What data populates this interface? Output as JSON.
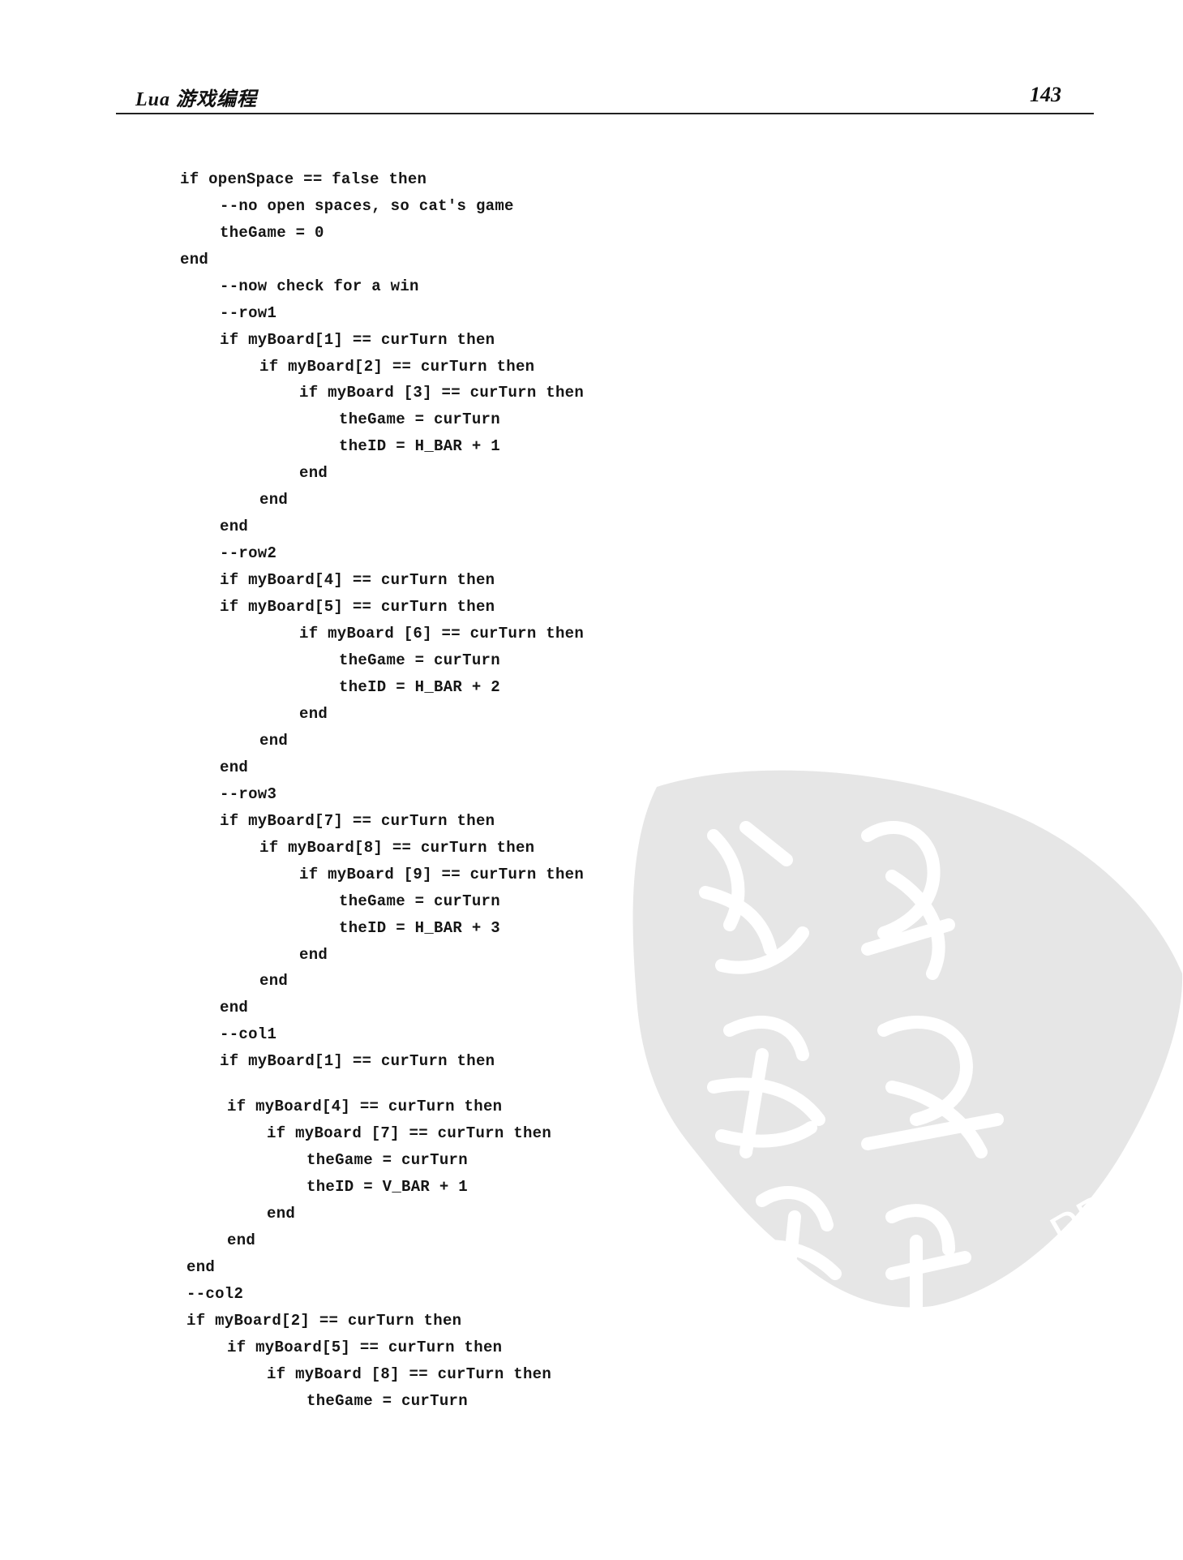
{
  "header": {
    "book_title": "Lua 游戏编程",
    "page_number": "143"
  },
  "watermark": {
    "label": "PDG",
    "colors": {
      "seal": "#e6e6e6",
      "glyph": "#ffffff"
    }
  },
  "code_lines": [
    "if openSpace == false then",
    "--no open spaces, so cat's game",
    "theGame = 0",
    "end",
    "--now check for a win",
    "--row1",
    "if myBoard[1] == curTurn then",
    "if myBoard[2] == curTurn then",
    "if myBoard [3] == curTurn then",
    "theGame = curTurn",
    "theID = H_BAR + 1",
    "end",
    "end",
    "end",
    "--row2",
    "if myBoard[4] == curTurn then",
    "if myBoard[5] == curTurn then",
    "if myBoard [6] == curTurn then",
    "theGame = curTurn",
    "theID = H_BAR + 2",
    "end",
    "end",
    "end",
    "--row3",
    "if myBoard[7] == curTurn then",
    "if myBoard[8] == curTurn then",
    "if myBoard [9] == curTurn then",
    "theGame = curTurn",
    "theID = H_BAR + 3",
    "end",
    "end",
    "end",
    "--col1",
    "if myBoard[1] == curTurn then",
    "if myBoard[4] == curTurn then",
    "if myBoard [7] == curTurn then",
    "theGame = curTurn",
    "theID = V_BAR + 1",
    "end",
    "end",
    "end",
    "--col2",
    "if myBoard[2] == curTurn then",
    "if myBoard[5] == curTurn then",
    "if myBoard [8] == curTurn then",
    "theGame = curTurn"
  ]
}
